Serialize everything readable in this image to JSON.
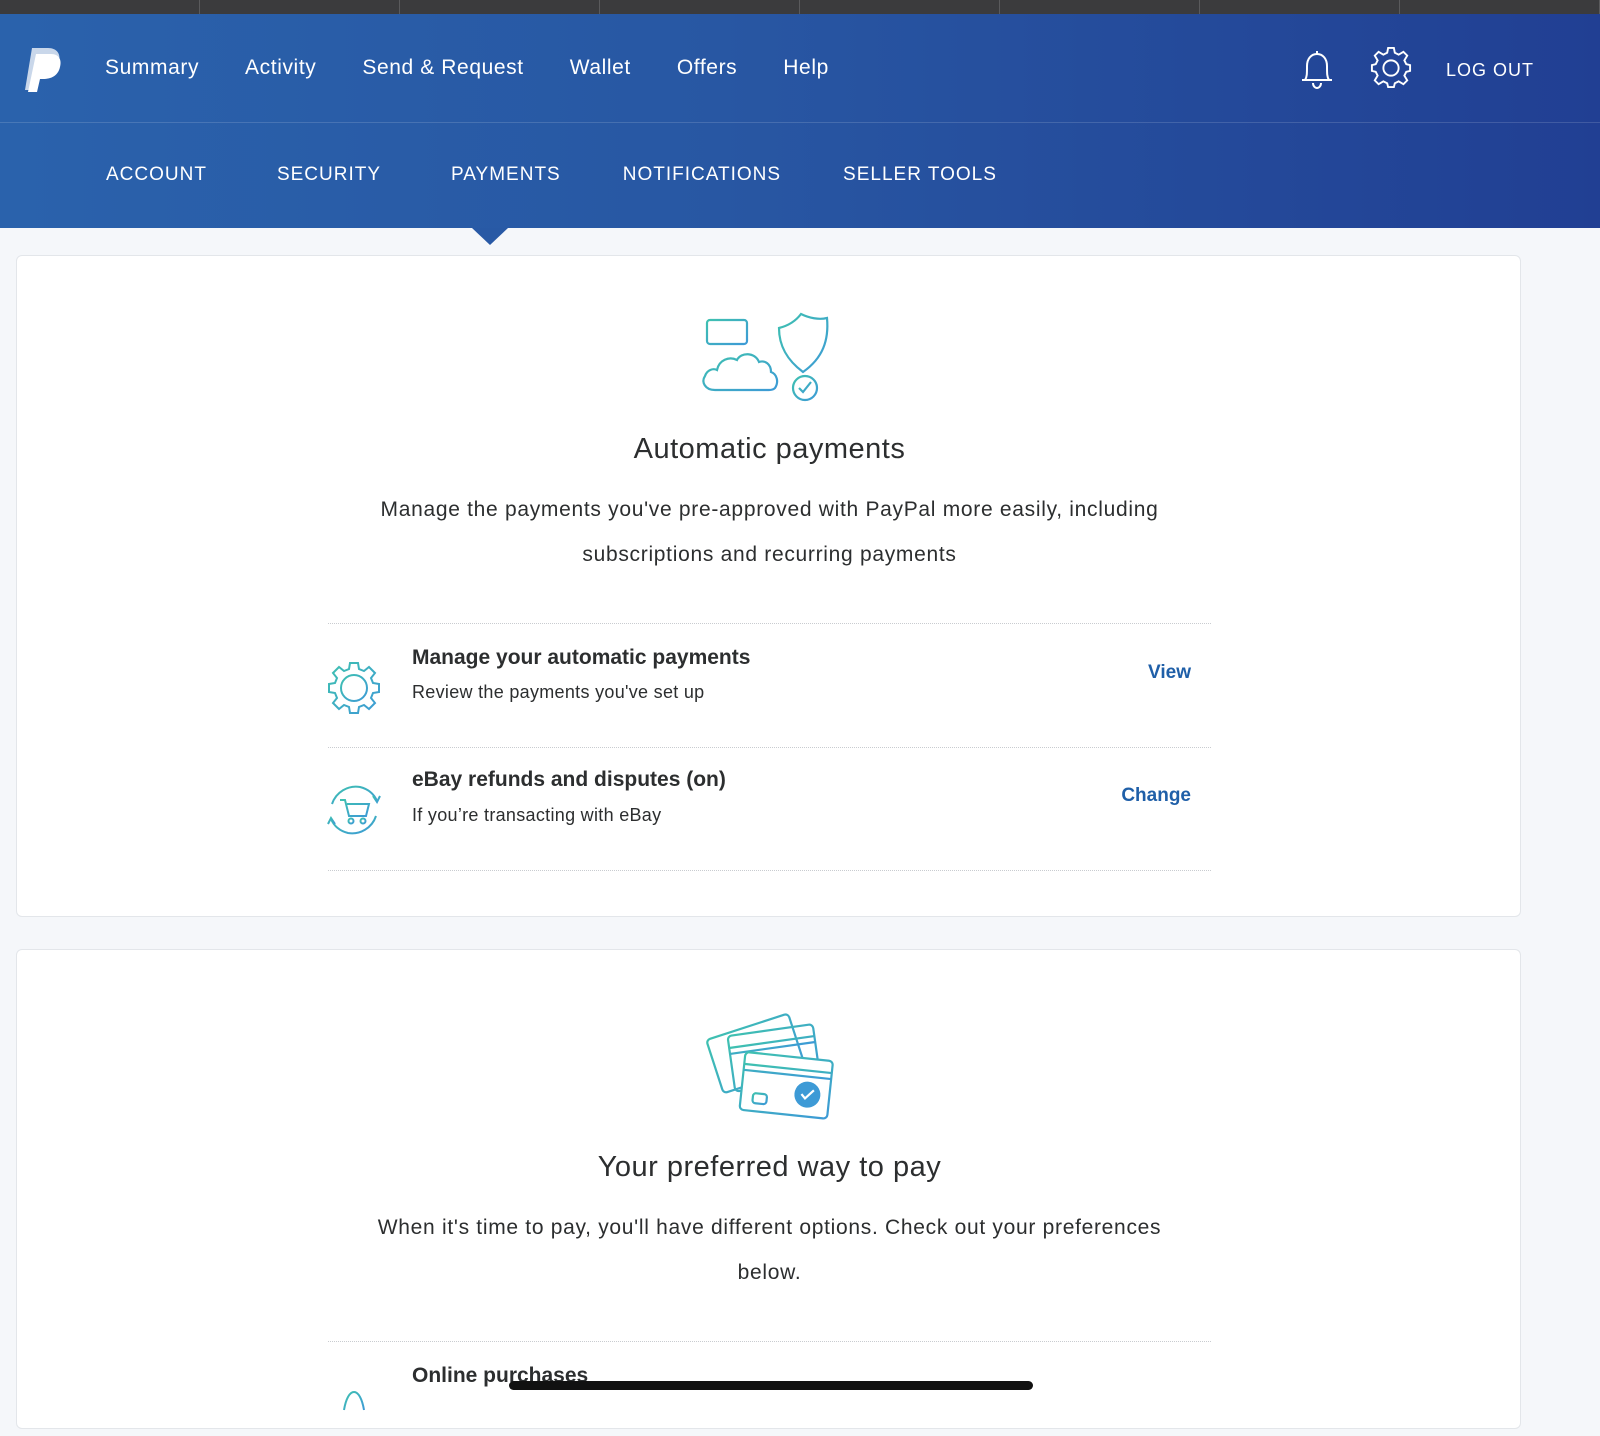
{
  "header": {
    "logo_icon": "paypal-logo",
    "nav": [
      "Summary",
      "Activity",
      "Send & Request",
      "Wallet",
      "Offers",
      "Help"
    ],
    "notifications_icon": "bell-icon",
    "settings_icon": "gear-icon",
    "logout_label": "LOG OUT"
  },
  "subnav": {
    "tabs": [
      "ACCOUNT",
      "SECURITY",
      "PAYMENTS",
      "NOTIFICATIONS",
      "SELLER TOOLS"
    ],
    "active_tab": "PAYMENTS"
  },
  "automatic_payments": {
    "illustration_icon": "cloud-card-shield-icon",
    "title": "Automatic payments",
    "description": "Manage the payments you've pre-approved with PayPal more easily, including subscriptions and recurring payments",
    "rows": [
      {
        "icon": "gear-outline-icon",
        "title": "Manage your automatic payments",
        "subtitle": "Review the payments you've set up",
        "action": "View"
      },
      {
        "icon": "cart-refresh-icon",
        "title": "eBay refunds and disputes (on)",
        "subtitle": "If you’re transacting with eBay",
        "action": "Change"
      }
    ]
  },
  "preferred_payment": {
    "illustration_icon": "cards-check-icon",
    "title": "Your preferred way to pay",
    "description": "When it's time to pay, you'll have different options. Check out your preferences below.",
    "rows": [
      {
        "icon": "tag-icon",
        "title": "Online purchases"
      }
    ]
  },
  "colors": {
    "header_start": "#2a62ac",
    "header_end": "#213f93",
    "link": "#1f5fa8",
    "icon_teal": "#3fc1b0",
    "icon_blue": "#3d9ad6"
  }
}
